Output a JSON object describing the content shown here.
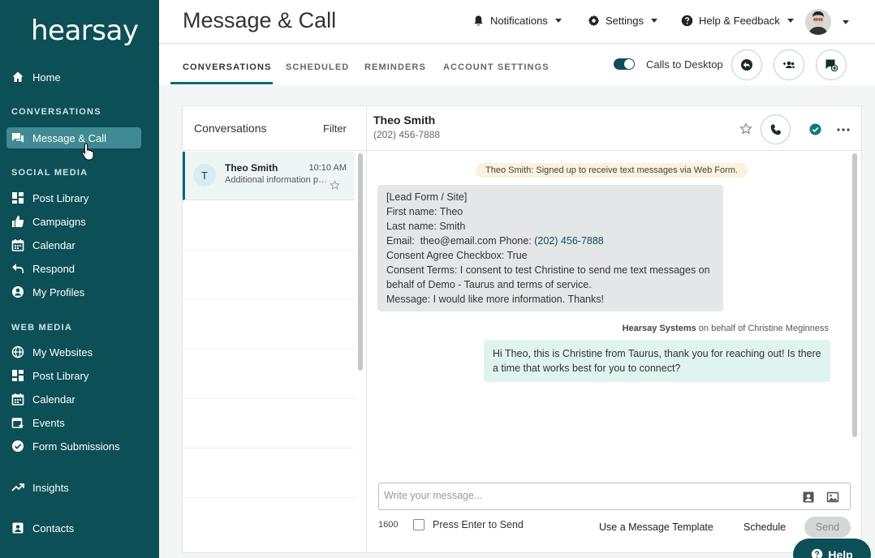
{
  "brand": {
    "logo": "hearsay",
    "accent": "#0d4f57",
    "active_bg": "#3f8a93"
  },
  "sidebar": {
    "home": "Home",
    "sections": {
      "conversations": "CONVERSATIONS",
      "social": "SOCIAL MEDIA",
      "web": "WEB MEDIA"
    },
    "conversations_items": [
      {
        "label": "Message & Call",
        "icon": "chat-icon",
        "active": true
      }
    ],
    "social_items": [
      {
        "label": "Post Library",
        "icon": "grid-icon"
      },
      {
        "label": "Campaigns",
        "icon": "thumbs-up-icon"
      },
      {
        "label": "Calendar",
        "icon": "calendar-icon"
      },
      {
        "label": "Respond",
        "icon": "reply-icon"
      },
      {
        "label": "My Profiles",
        "icon": "profile-icon"
      }
    ],
    "web_items": [
      {
        "label": "My Websites",
        "icon": "globe-icon"
      },
      {
        "label": "Post Library",
        "icon": "grid-icon"
      },
      {
        "label": "Calendar",
        "icon": "calendar-icon"
      },
      {
        "label": "Events",
        "icon": "event-icon"
      },
      {
        "label": "Form Submissions",
        "icon": "check-circle-icon"
      }
    ],
    "insights": "Insights",
    "contacts": "Contacts"
  },
  "header": {
    "title": "Message & Call",
    "notifications": "Notifications",
    "settings": "Settings",
    "help": "Help & Feedback"
  },
  "tabs": {
    "items": [
      "CONVERSATIONS",
      "SCHEDULED",
      "REMINDERS",
      "ACCOUNT SETTINGS"
    ],
    "active": "CONVERSATIONS",
    "calls_toggle_label": "Calls to Desktop",
    "calls_toggle_on": true
  },
  "conversations": {
    "title": "Conversations",
    "filter": "Filter",
    "items": [
      {
        "initial": "T",
        "name": "Theo Smith",
        "time": "10:10 AM",
        "preview": "Additional information provided"
      }
    ]
  },
  "thread": {
    "contact_name": "Theo Smith",
    "contact_phone": "(202) 456-7888",
    "system_note": "Theo Smith: Signed up to receive text messages via Web Form.",
    "incoming": {
      "line1": "[Lead Form / Site]",
      "line2": "First name: Theo",
      "line3": "Last name: Smith",
      "email_label": "Email:",
      "email": "theo@email.com",
      "phone_label": "Phone:",
      "phone": "(202) 456-7888",
      "line5": "Consent Agree Checkbox: True",
      "line6": "Consent Terms: I consent to test Christine to send me text messages on behalf of Demo - Taurus and terms of service.",
      "line7": "Message: I would like more information. Thanks!"
    },
    "sender_org": "Hearsay Systems",
    "sender_suffix": "on behalf of Christine Meginness",
    "outgoing": "Hi Theo, this is Christine from Taurus, thank you for reaching out! Is there a time that works best for you to connect?"
  },
  "composer": {
    "placeholder": "Write your message...",
    "char_count": "1600",
    "enter_to_send": "Press Enter to Send",
    "template": "Use a Message Template",
    "schedule": "Schedule",
    "send": "Send"
  },
  "help_button": "Help"
}
